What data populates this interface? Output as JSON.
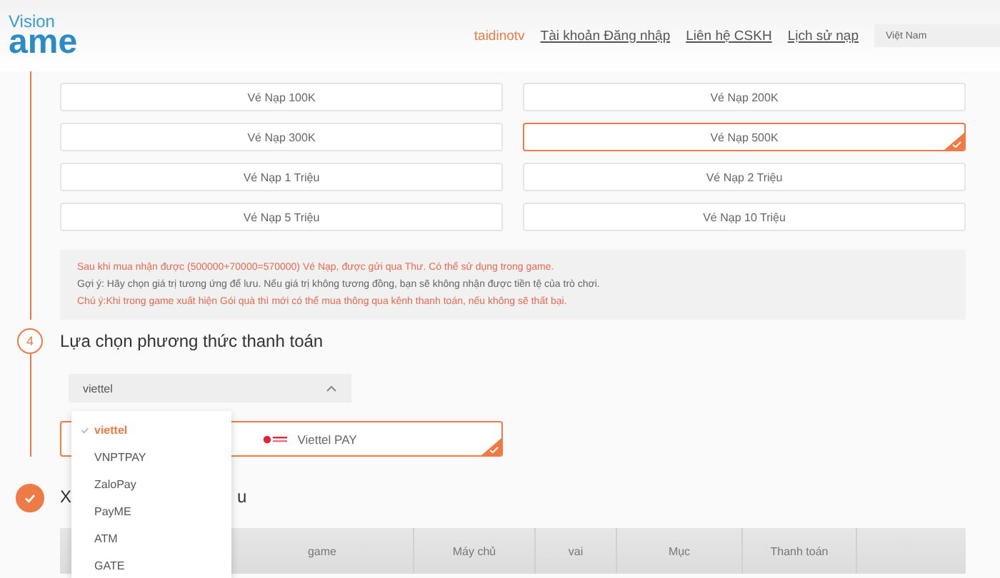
{
  "header": {
    "logo": {
      "top": "Vision",
      "bottom": "ame"
    },
    "nav": [
      {
        "label": "taidinotv",
        "kind": "user"
      },
      {
        "label": "Tài khoản Đăng nhập",
        "kind": "link"
      },
      {
        "label": "Liên hệ CSKH",
        "kind": "link"
      },
      {
        "label": "Lịch sử nạp",
        "kind": "link"
      }
    ],
    "region_field": {
      "value": "Việt Nam"
    }
  },
  "packages": [
    {
      "label": "Vé Nạp 100K",
      "selected": false
    },
    {
      "label": "Vé Nạp 200K",
      "selected": false
    },
    {
      "label": "Vé Nạp 300K",
      "selected": false
    },
    {
      "label": "Vé Nạp 500K",
      "selected": true
    },
    {
      "label": "Vé Nạp 1 Triệu",
      "selected": false
    },
    {
      "label": "Vé Nạp 2 Triệu",
      "selected": false
    },
    {
      "label": "Vé Nạp 5 Triệu",
      "selected": false
    },
    {
      "label": "Vé Nạp 10 Triệu",
      "selected": false
    }
  ],
  "notice": [
    {
      "kind": "warning",
      "text": "Sau khi mua nhận được (500000+70000=570000) Vé Nạp, được gửi qua Thư. Có thể sử dụng trong game."
    },
    {
      "kind": "hint",
      "text": "Gợi ý: Hãy chọn giá trị tương ứng để lưu. Nếu giá trị không tương đồng, bạn sẽ không nhận được tiền tệ của trò chơi."
    },
    {
      "kind": "warning",
      "text": "Chú ý:Khi trong game xuất hiện Gói quà thì mới có thể mua thông qua kênh thanh toán, nếu không sẽ thất bại."
    }
  ],
  "step_payment": {
    "number": "4",
    "title": "Lựa chọn phương thức thanh toán",
    "select": {
      "value": "viettel",
      "expanded": true
    },
    "dropdown": [
      {
        "label": "viettel",
        "selected": true
      },
      {
        "label": "VNPTPAY",
        "selected": false
      },
      {
        "label": "ZaloPay",
        "selected": false
      },
      {
        "label": "PayME",
        "selected": false
      },
      {
        "label": "ATM",
        "selected": false
      },
      {
        "label": "GATE",
        "selected": false
      }
    ],
    "methods": [
      {
        "label": "Viettel PAY",
        "selected": true
      }
    ]
  },
  "step_confirm": {
    "done": true,
    "title_start": "X",
    "title_end": "u",
    "table": {
      "columns": [
        "game",
        "Máy chủ",
        "vai",
        "Mục",
        "Thanh toán"
      ]
    }
  }
}
